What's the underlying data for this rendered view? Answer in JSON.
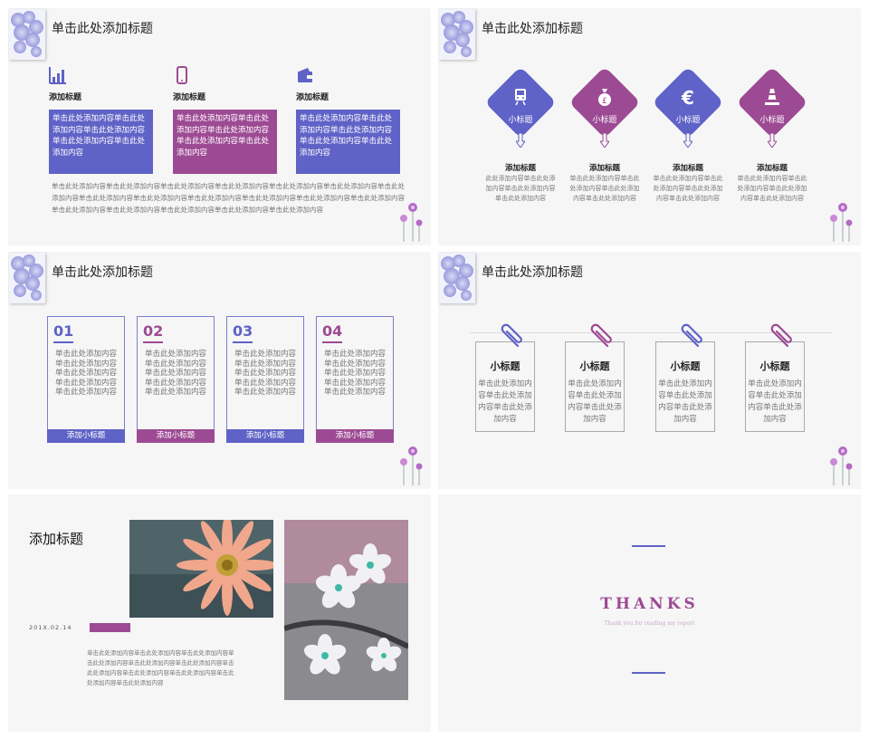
{
  "colors": {
    "blue": "#5f62c6",
    "purple": "#9d4a94",
    "background": "#f6f6f6"
  },
  "slide1": {
    "title": "单击此处添加标题",
    "columns": [
      {
        "icon": "bar-chart-icon",
        "label": "添加标题",
        "text": "单击此处添加内容单击此处添加内容单击此处添加内容单击此处添加内容单击此处添加内容",
        "color": "blue"
      },
      {
        "icon": "mobile-phone-icon",
        "label": "添加标题",
        "text": "单击此处添加内容单击此处添加内容单击此处添加内容单击此处添加内容单击此处添加内容",
        "color": "purple"
      },
      {
        "icon": "wallet-icon",
        "label": "添加标题",
        "text": "单击此处添加内容单击此处添加内容单击此处添加内容单击此处添加内容单击此处添加内容",
        "color": "blue"
      }
    ],
    "paragraph": "单击此处添加内容单击此处添加内容单击此处添加内容单击此处添加内容单击此处添加内容单击此处添加内容单击此处添加内容单击此处添加内容单击此处添加内容单击此处添加内容单击此处添加内容单击此处添加内容单击此处添加内容单击此处添加内容单击此处添加内容单击此处添加内容单击此处添加内容单击此处添加内容"
  },
  "slide2": {
    "title": "单击此处添加标题",
    "items": [
      {
        "icon": "train-icon",
        "inner_label": "小标题",
        "label": "添加标题",
        "text": "此处添加内容单击此处添加内容单击此处添加内容单击此处添加内容",
        "color": "blue"
      },
      {
        "icon": "money-bag-icon",
        "inner_label": "小标题",
        "label": "添加标题",
        "text": "单击此处添加内容单击此处添加内容单击此处添加内容单击此处添加内容",
        "color": "purple"
      },
      {
        "icon": "euro-icon",
        "inner_label": "小标题",
        "label": "添加标题",
        "text": "单击此处添加内容单击此处添加内容单击此处添加内容单击此处添加内容",
        "color": "blue"
      },
      {
        "icon": "traffic-cone-icon",
        "inner_label": "小标题",
        "label": "添加标题",
        "text": "单击此处添加内容单击此处添加内容单击此处添加内容单击此处添加内容",
        "color": "purple"
      }
    ]
  },
  "slide3": {
    "title": "单击此处添加标题",
    "cards": [
      {
        "num": "01",
        "text": "单击此处添加内容单击此处添加内容单击此处添加内容单击此处添加内容单击此处添加内容",
        "bar": "添加小标题",
        "color": "blue"
      },
      {
        "num": "02",
        "text": "单击此处添加内容单击此处添加内容单击此处添加内容单击此处添加内容单击此处添加内容",
        "bar": "添加小标题",
        "color": "purple"
      },
      {
        "num": "03",
        "text": "单击此处添加内容单击此处添加内容单击此处添加内容单击此处添加内容单击此处添加内容",
        "bar": "添加小标题",
        "color": "blue"
      },
      {
        "num": "04",
        "text": "单击此处添加内容单击此处添加内容单击此处添加内容单击此处添加内容单击此处添加内容",
        "bar": "添加小标题",
        "color": "purple"
      }
    ]
  },
  "slide4": {
    "title": "单击此处添加标题",
    "cards": [
      {
        "title": "小标题",
        "text": "单击此处添加内容单击此处添加内容单击此处添加内容",
        "clip": "blue"
      },
      {
        "title": "小标题",
        "text": "单击此处添加内容单击此处添加内容单击此处添加内容",
        "clip": "purple"
      },
      {
        "title": "小标题",
        "text": "单击此处添加内容单击此处添加内容单击此处添加内容",
        "clip": "blue"
      },
      {
        "title": "小标题",
        "text": "单击此处添加内容单击此处添加内容单击此处添加内容",
        "clip": "purple"
      }
    ]
  },
  "slide5": {
    "title": "添加标题",
    "date": "201X.02.14",
    "text": "单击此处添加内容单击此处添加内容单击此处添加内容单击此处添加内容单击此处添加内容单击此处添加内容单击此处添加内容单击此处添加内容单击此处添加内容单击此处添加内容单击此处添加内容"
  },
  "slide6": {
    "thanks": "THANKS",
    "subtitle": "Thank you for reading my report"
  }
}
